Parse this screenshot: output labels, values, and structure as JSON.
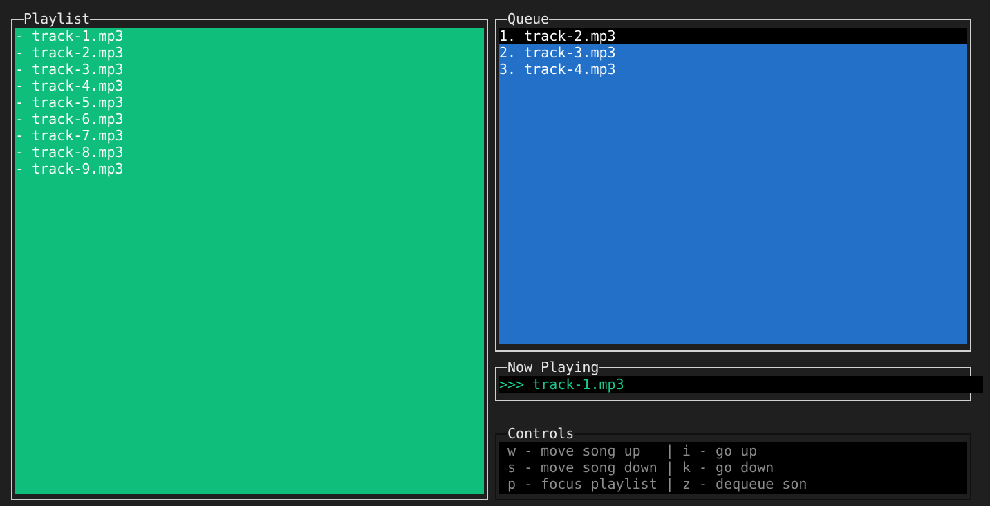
{
  "playlist": {
    "title": "Playlist",
    "items": [
      "- track-1.mp3",
      "- track-2.mp3",
      "- track-3.mp3",
      "- track-4.mp3",
      "- track-5.mp3",
      "- track-6.mp3",
      "- track-7.mp3",
      "- track-8.mp3",
      "- track-9.mp3"
    ],
    "bg_color": "#0fbe7a"
  },
  "queue": {
    "title": "Queue",
    "items": [
      "1. track-2.mp3",
      "2. track-3.mp3",
      "3. track-4.mp3"
    ],
    "selected_index": 0,
    "bg_color": "#2370c9"
  },
  "now_playing": {
    "title": "Now Playing",
    "text": ">>> track-1.mp3",
    "text_color": "#19c98a"
  },
  "controls": {
    "title": "Controls",
    "lines": [
      "w - move song up   | i - go up",
      "s - move song down | k - go down",
      "p - focus playlist | z - dequeue son"
    ]
  }
}
